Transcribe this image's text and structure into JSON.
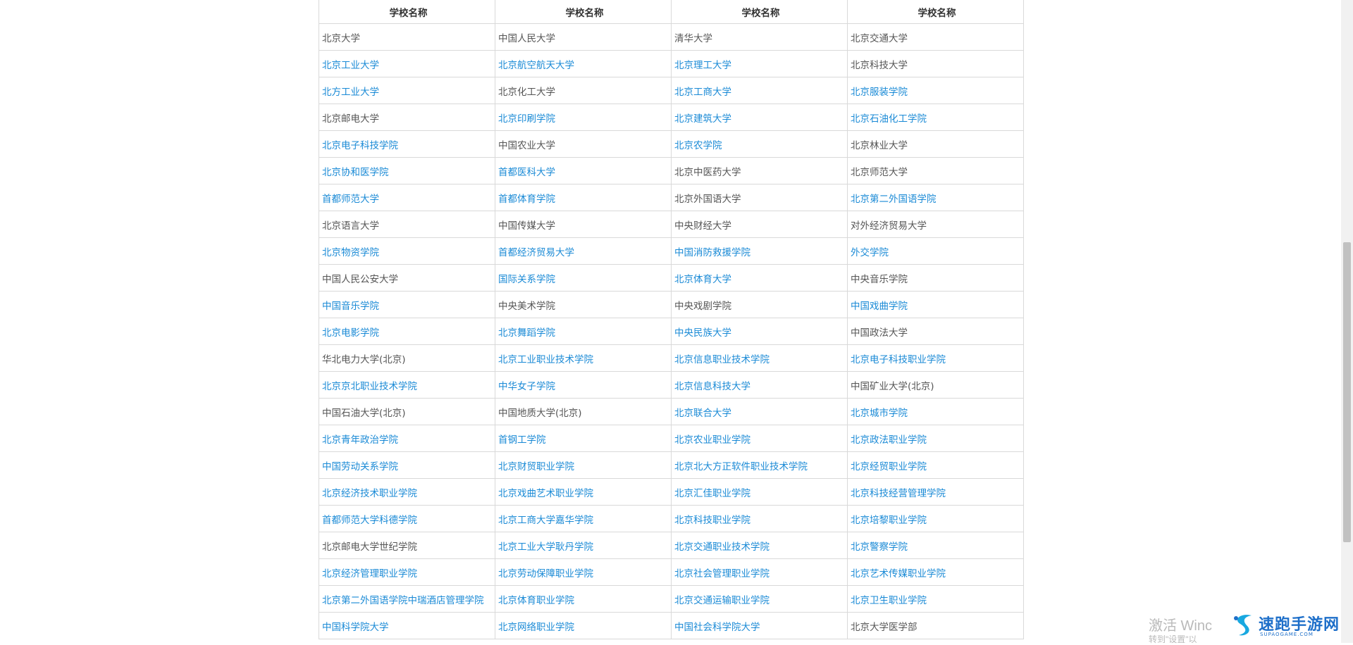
{
  "table": {
    "headers": [
      "学校名称",
      "学校名称",
      "学校名称",
      "学校名称"
    ],
    "rows": [
      [
        {
          "t": "北京大学",
          "link": false
        },
        {
          "t": "中国人民大学",
          "link": false
        },
        {
          "t": "清华大学",
          "link": false
        },
        {
          "t": "北京交通大学",
          "link": false
        }
      ],
      [
        {
          "t": "北京工业大学",
          "link": true
        },
        {
          "t": "北京航空航天大学",
          "link": true
        },
        {
          "t": "北京理工大学",
          "link": true
        },
        {
          "t": "北京科技大学",
          "link": false
        }
      ],
      [
        {
          "t": "北方工业大学",
          "link": true
        },
        {
          "t": "北京化工大学",
          "link": false
        },
        {
          "t": "北京工商大学",
          "link": true
        },
        {
          "t": "北京服装学院",
          "link": true
        }
      ],
      [
        {
          "t": "北京邮电大学",
          "link": false
        },
        {
          "t": "北京印刷学院",
          "link": true
        },
        {
          "t": "北京建筑大学",
          "link": true
        },
        {
          "t": "北京石油化工学院",
          "link": true
        }
      ],
      [
        {
          "t": "北京电子科技学院",
          "link": true
        },
        {
          "t": "中国农业大学",
          "link": false
        },
        {
          "t": "北京农学院",
          "link": true
        },
        {
          "t": "北京林业大学",
          "link": false
        }
      ],
      [
        {
          "t": "北京协和医学院",
          "link": true
        },
        {
          "t": "首都医科大学",
          "link": true
        },
        {
          "t": "北京中医药大学",
          "link": false
        },
        {
          "t": "北京师范大学",
          "link": false
        }
      ],
      [
        {
          "t": "首都师范大学",
          "link": true
        },
        {
          "t": "首都体育学院",
          "link": true
        },
        {
          "t": "北京外国语大学",
          "link": false
        },
        {
          "t": "北京第二外国语学院",
          "link": true
        }
      ],
      [
        {
          "t": "北京语言大学",
          "link": false
        },
        {
          "t": "中国传媒大学",
          "link": false
        },
        {
          "t": "中央财经大学",
          "link": false
        },
        {
          "t": "对外经济贸易大学",
          "link": false
        }
      ],
      [
        {
          "t": "北京物资学院",
          "link": true
        },
        {
          "t": "首都经济贸易大学",
          "link": true
        },
        {
          "t": "中国消防救援学院",
          "link": true
        },
        {
          "t": "外交学院",
          "link": true
        }
      ],
      [
        {
          "t": "中国人民公安大学",
          "link": false
        },
        {
          "t": "国际关系学院",
          "link": true
        },
        {
          "t": "北京体育大学",
          "link": true
        },
        {
          "t": "中央音乐学院",
          "link": false
        }
      ],
      [
        {
          "t": "中国音乐学院",
          "link": true
        },
        {
          "t": "中央美术学院",
          "link": false
        },
        {
          "t": "中央戏剧学院",
          "link": false
        },
        {
          "t": "中国戏曲学院",
          "link": true
        }
      ],
      [
        {
          "t": "北京电影学院",
          "link": true
        },
        {
          "t": "北京舞蹈学院",
          "link": true
        },
        {
          "t": "中央民族大学",
          "link": true
        },
        {
          "t": "中国政法大学",
          "link": false
        }
      ],
      [
        {
          "t": "华北电力大学(北京)",
          "link": false
        },
        {
          "t": "北京工业职业技术学院",
          "link": true
        },
        {
          "t": "北京信息职业技术学院",
          "link": true
        },
        {
          "t": "北京电子科技职业学院",
          "link": true
        }
      ],
      [
        {
          "t": "北京京北职业技术学院",
          "link": true
        },
        {
          "t": "中华女子学院",
          "link": true
        },
        {
          "t": "北京信息科技大学",
          "link": true
        },
        {
          "t": "中国矿业大学(北京)",
          "link": false
        }
      ],
      [
        {
          "t": "中国石油大学(北京)",
          "link": false
        },
        {
          "t": "中国地质大学(北京)",
          "link": false
        },
        {
          "t": "北京联合大学",
          "link": true
        },
        {
          "t": "北京城市学院",
          "link": true
        }
      ],
      [
        {
          "t": "北京青年政治学院",
          "link": true
        },
        {
          "t": "首钢工学院",
          "link": true
        },
        {
          "t": "北京农业职业学院",
          "link": true
        },
        {
          "t": "北京政法职业学院",
          "link": true
        }
      ],
      [
        {
          "t": "中国劳动关系学院",
          "link": true
        },
        {
          "t": "北京财贸职业学院",
          "link": true
        },
        {
          "t": "北京北大方正软件职业技术学院",
          "link": true
        },
        {
          "t": "北京经贸职业学院",
          "link": true
        }
      ],
      [
        {
          "t": "北京经济技术职业学院",
          "link": true
        },
        {
          "t": "北京戏曲艺术职业学院",
          "link": true
        },
        {
          "t": "北京汇佳职业学院",
          "link": true
        },
        {
          "t": "北京科技经营管理学院",
          "link": true
        }
      ],
      [
        {
          "t": "首都师范大学科德学院",
          "link": true
        },
        {
          "t": "北京工商大学嘉华学院",
          "link": true
        },
        {
          "t": "北京科技职业学院",
          "link": true
        },
        {
          "t": "北京培黎职业学院",
          "link": true
        }
      ],
      [
        {
          "t": "北京邮电大学世纪学院",
          "link": false
        },
        {
          "t": "北京工业大学耿丹学院",
          "link": true
        },
        {
          "t": "北京交通职业技术学院",
          "link": true
        },
        {
          "t": "北京警察学院",
          "link": true
        }
      ],
      [
        {
          "t": "北京经济管理职业学院",
          "link": true
        },
        {
          "t": "北京劳动保障职业学院",
          "link": true
        },
        {
          "t": "北京社会管理职业学院",
          "link": true
        },
        {
          "t": "北京艺术传媒职业学院",
          "link": true
        }
      ],
      [
        {
          "t": "北京第二外国语学院中瑞酒店管理学院",
          "link": true
        },
        {
          "t": "北京体育职业学院",
          "link": true
        },
        {
          "t": "北京交通运输职业学院",
          "link": true
        },
        {
          "t": "北京卫生职业学院",
          "link": true
        }
      ],
      [
        {
          "t": "中国科学院大学",
          "link": true
        },
        {
          "t": "北京网络职业学院",
          "link": true
        },
        {
          "t": "中国社会科学院大学",
          "link": true
        },
        {
          "t": "北京大学医学部",
          "link": false
        }
      ]
    ]
  },
  "watermark": {
    "line1": "激活 Winc",
    "line2": "转到\"设置\"以"
  },
  "logo": {
    "name": "速跑手游网",
    "sub": "SUPAOGAME.COM",
    "icon": "swirl-logo-icon"
  },
  "colors": {
    "link": "#1a8ad6",
    "text": "#555555",
    "border": "#d9d9d9"
  }
}
